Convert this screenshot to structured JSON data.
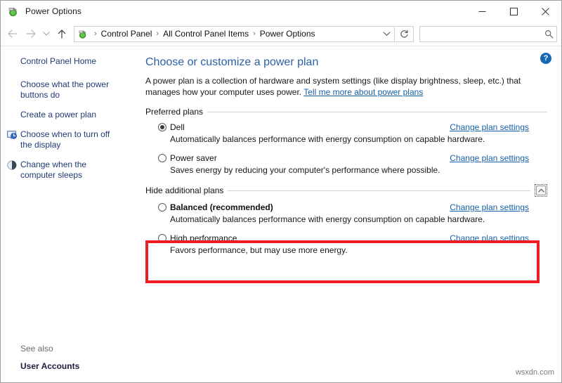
{
  "window": {
    "title": "Power Options",
    "icon": "power-plug-icon",
    "caption": {
      "minimize": "minimize-icon",
      "maximize": "maximize-icon",
      "close": "close-icon"
    }
  },
  "navbar": {
    "back": "back-arrow-icon",
    "forward": "forward-arrow-icon",
    "recent": "recent-locations-icon",
    "up": "up-arrow-icon",
    "address_icon": "power-plug-icon",
    "breadcrumbs": [
      "Control Panel",
      "All Control Panel Items",
      "Power Options"
    ],
    "separator": "›",
    "dropdown": "chevron-down-icon",
    "refresh": "refresh-icon",
    "search": {
      "value": "",
      "placeholder": "",
      "icon": "search-icon"
    }
  },
  "sidebar": {
    "items": [
      {
        "label": "Control Panel Home",
        "icon": null
      },
      {
        "label": "Choose what the power buttons do",
        "icon": null
      },
      {
        "label": "Create a power plan",
        "icon": null
      },
      {
        "label": "Choose when to turn off the display",
        "icon": "display-clock-icon"
      },
      {
        "label": "Change when the computer sleeps",
        "icon": "moon-sleep-icon"
      }
    ],
    "see_also": {
      "title": "See also",
      "link": "User Accounts"
    }
  },
  "content": {
    "help_icon": "help-question-icon",
    "help_label": "?",
    "title": "Choose or customize a power plan",
    "intro_text_1": "A power plan is a collection of hardware and system settings (like display brightness, sleep, etc.) that manages how your computer uses power. ",
    "intro_link": "Tell me more about power plans",
    "groups": [
      {
        "label": "Preferred plans",
        "collapse_button": null,
        "plans": [
          {
            "name": "Dell",
            "bold": false,
            "selected": true,
            "description": "Automatically balances performance with energy consumption on capable hardware.",
            "link": "Change plan settings"
          },
          {
            "name": "Power saver",
            "bold": false,
            "selected": false,
            "description": "Saves energy by reducing your computer's performance where possible.",
            "link": "Change plan settings"
          }
        ]
      },
      {
        "label": "Hide additional plans",
        "collapse_button": "chevron-up-icon",
        "plans": [
          {
            "name": "Balanced (recommended)",
            "bold": true,
            "selected": false,
            "description": "Automatically balances performance with energy consumption on capable hardware.",
            "link": "Change plan settings"
          },
          {
            "name": "High performance",
            "bold": false,
            "selected": false,
            "description": "Favors performance, but may use more energy.",
            "link": "Change plan settings"
          }
        ]
      }
    ]
  },
  "annotation": {
    "highlight_color": "#ee1c25",
    "target": "High performance"
  },
  "watermark": "wsxdn.com",
  "colors": {
    "link": "#1660a8",
    "title": "#2c5fa8",
    "sidebar_link": "#1f3b73",
    "highlight": "#ee1c25"
  }
}
